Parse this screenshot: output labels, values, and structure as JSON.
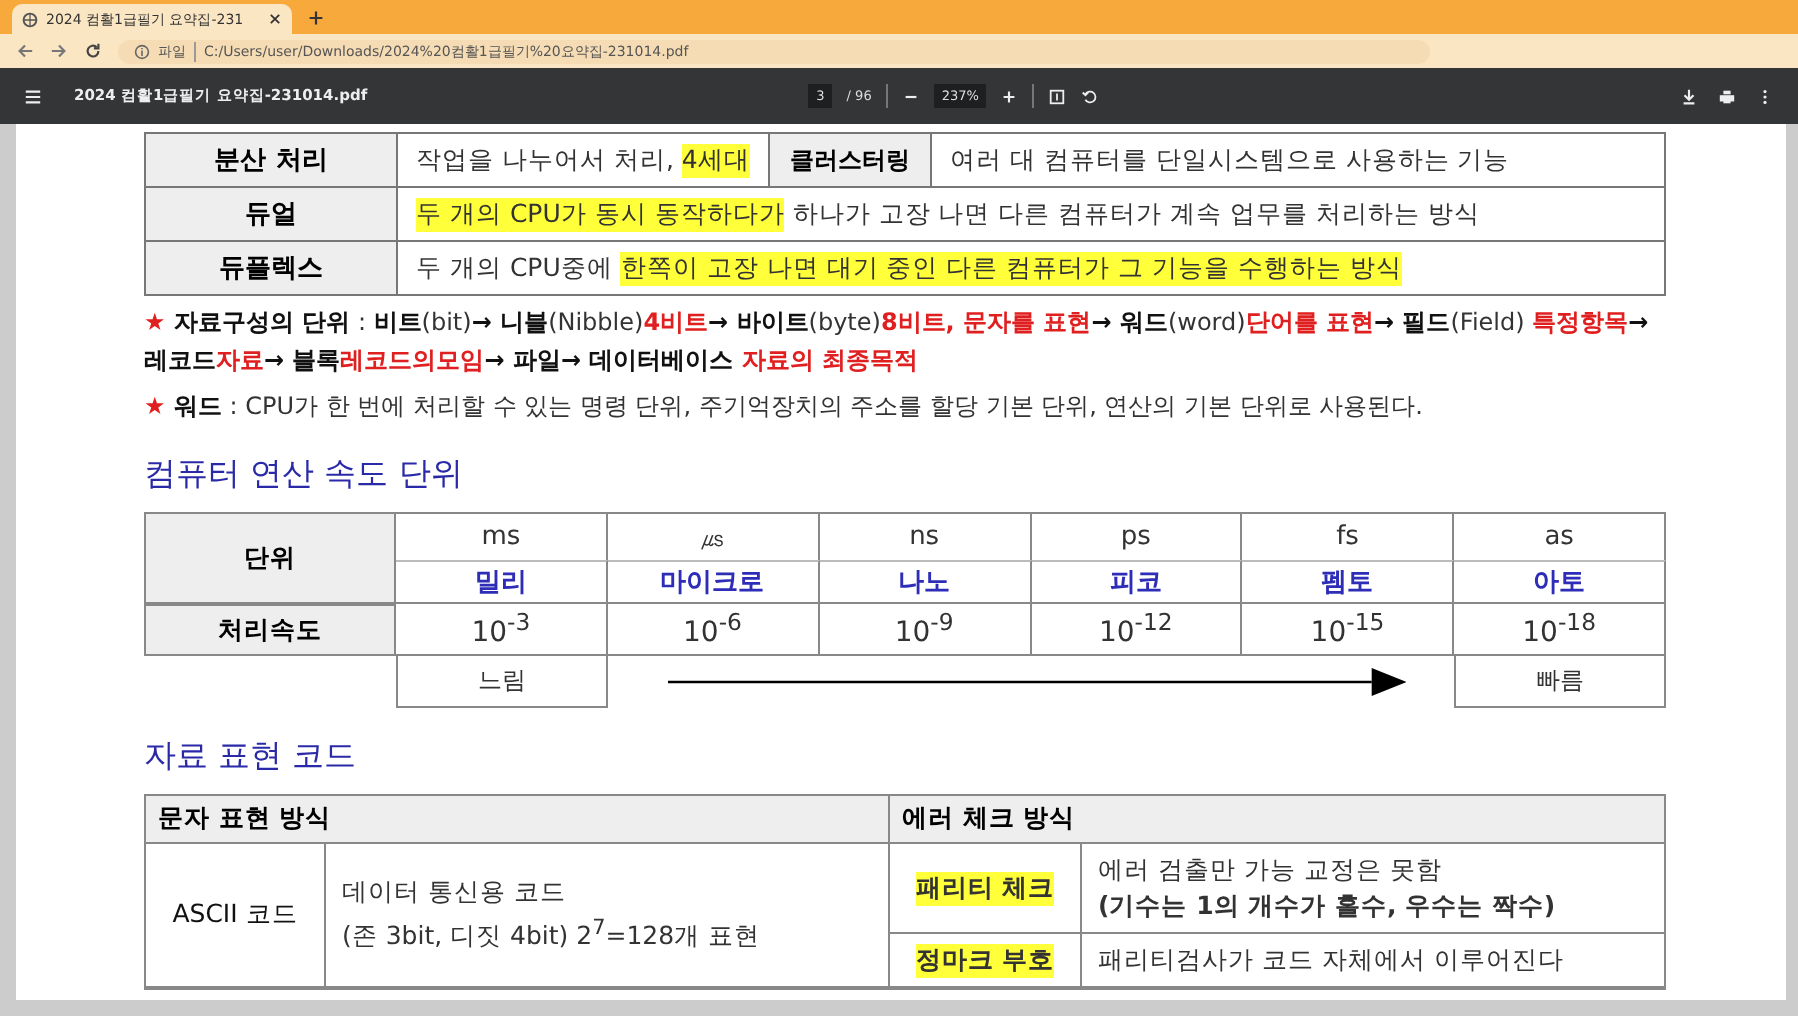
{
  "browser": {
    "tab_title": "2024 컴활1급필기 요약집-231",
    "address_label": "파일",
    "address": "C:/Users/user/Downloads/2024%20컴활1급필기%20요약집-231014.pdf"
  },
  "pdf_toolbar": {
    "title": "2024 컴활1급필기 요약집-231014.pdf",
    "page": "3",
    "page_total": "/ 96",
    "zoom": "237%"
  },
  "top_table": [
    {
      "label": "분산 처리",
      "cells": [
        {
          "kind": "text",
          "segments": [
            {
              "text": "작업을 나누어서 처리, ",
              "highlight": false
            },
            {
              "text": "4세대",
              "highlight": true
            }
          ]
        },
        {
          "kind": "header",
          "segments": [
            {
              "text": "클러스터링",
              "highlight": false
            }
          ]
        },
        {
          "kind": "text",
          "segments": [
            {
              "text": "여러 대 컴퓨터를 단일시스템으로 사용하는 기능",
              "highlight": false
            }
          ]
        }
      ]
    },
    {
      "label": "듀얼",
      "cells": [
        {
          "kind": "text",
          "segments": [
            {
              "text": "두 개의 CPU가 동시 동작하다가",
              "highlight": true
            },
            {
              "text": " 하나가 고장 나면 다른 컴퓨터가 계속 업무를 처리하는 방식",
              "highlight": false
            }
          ]
        }
      ]
    },
    {
      "label": "듀플렉스",
      "cells": [
        {
          "kind": "text",
          "segments": [
            {
              "text": "두 개의 CPU중에 ",
              "highlight": false
            },
            {
              "text": "한쪽이 고장 나면 대기 중인 다른 컴퓨터가 그 기능을 수행하는 방식",
              "highlight": true
            }
          ]
        }
      ]
    }
  ],
  "notes": [
    [
      {
        "text": "★ ",
        "kind": "red"
      },
      {
        "text": "자료구성의 단위",
        "kind": "bold"
      },
      {
        "text": " : ",
        "kind": "plain"
      },
      {
        "text": "비트",
        "kind": "bold"
      },
      {
        "text": "(bit)",
        "kind": "plain"
      },
      {
        "text": "→ 니블",
        "kind": "bold"
      },
      {
        "text": "(Nibble)",
        "kind": "plain"
      },
      {
        "text": "4비트",
        "kind": "red"
      },
      {
        "text": "→ 바이트",
        "kind": "bold"
      },
      {
        "text": "(byte)",
        "kind": "plain"
      },
      {
        "text": "8비트, 문자를 표현",
        "kind": "red"
      },
      {
        "text": "→ 워드",
        "kind": "bold"
      },
      {
        "text": "(word)",
        "kind": "plain"
      },
      {
        "text": "단어를 표현",
        "kind": "red"
      },
      {
        "text": "→ 필드",
        "kind": "bold"
      },
      {
        "text": "(Field) ",
        "kind": "plain"
      },
      {
        "text": "특정항목",
        "kind": "red"
      },
      {
        "text": "→ 레코드",
        "kind": "bold"
      },
      {
        "text": "자료",
        "kind": "red"
      },
      {
        "text": "→ 블록",
        "kind": "bold"
      },
      {
        "text": "레코드의모임",
        "kind": "red"
      },
      {
        "text": "→ 파일→ 데이터베이스 ",
        "kind": "bold"
      },
      {
        "text": "자료의 최종목적",
        "kind": "red"
      }
    ],
    [
      {
        "text": "★ ",
        "kind": "red"
      },
      {
        "text": "워드",
        "kind": "bold"
      },
      {
        "text": " : CPU가 한 번에 처리할 수 있는 명령 단위, 주기억장치의 주소를 할당 기본 단위, 연산의 기본 단위로 사용된다.",
        "kind": "plain"
      }
    ]
  ],
  "speed_section": {
    "title": "컴퓨터 연산 속도 단위",
    "unit_label": "단위",
    "speed_label": "처리속도",
    "columns": [
      {
        "unit": "ms",
        "name": "밀리",
        "speed": "10$^{-3}$"
      },
      {
        "unit": "㎲",
        "name": "마이크로",
        "speed": "10$^{-6}$"
      },
      {
        "unit": "ns",
        "name": "나노",
        "speed": "10$^{-9}$"
      },
      {
        "unit": "ps",
        "name": "피코",
        "speed": "10$^{-12}$"
      },
      {
        "unit": "fs",
        "name": "펨토",
        "speed": "10$^{-15}$"
      },
      {
        "unit": "as",
        "name": "아토",
        "speed": "10$^{-18}$"
      }
    ],
    "slow_label": "느림",
    "fast_label": "빠름"
  },
  "code_section": {
    "title": "자료 표현 코드",
    "char_header": "문자 표현 방식",
    "error_header": "에러 체크 방식",
    "char_row": {
      "name": "ASCII 코드",
      "lines": [
        "데이터 통신용 코드",
        "(존 3bit, 디짓 4bit) 2$^{7}$=128개 표현"
      ]
    },
    "error_rows": [
      {
        "name": "패리티 체크",
        "lines": [
          "에러 검출만 가능 교정은 못함",
          "**(기수는 1의 개수가 홀수, 우수는 짝수)**"
        ]
      },
      {
        "name": "정마크 부호",
        "lines": [
          "패리티검사가 코드 자체에서 이루어진다"
        ]
      }
    ]
  }
}
